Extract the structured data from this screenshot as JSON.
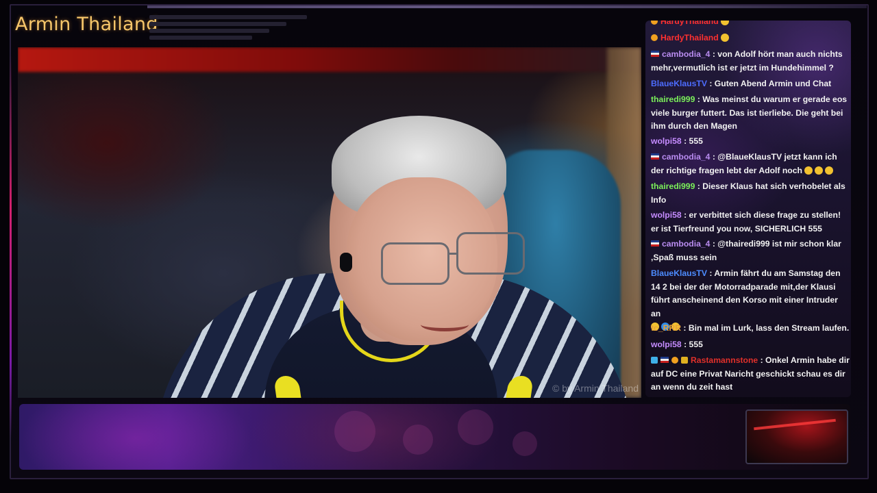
{
  "stream": {
    "title": "Armin Thailand",
    "watermark": "© by Armin Thailand"
  },
  "colors": {
    "title": "#f6c66a",
    "accent_pink": "#d4206e",
    "accent_purple": "#7a1aa8",
    "chat_bg": "#1b1430"
  },
  "chat": {
    "messages": [
      {
        "user": "HardyThailand",
        "text": "",
        "name_color": "#ff3030",
        "badges": [
          "sub-badge-icon"
        ],
        "emotes": [
          "clap-emoji-icon"
        ]
      },
      {
        "user": "cambodia_4",
        "text": ": von Adolf hört man auch nichts mehr,vermutlich ist er jetzt im Hundehimmel ?",
        "name_color": "#b98cf0",
        "badges": [
          "thai-flag-icon"
        ],
        "emotes": []
      },
      {
        "user": "BlaueKlausTV",
        "text": ": Guten Abend Armin und Chat",
        "name_color": "#4d6cff",
        "badges": [],
        "emotes": []
      },
      {
        "user": "thairedi999",
        "text": ": Was meinst du warum er gerade eos viele burger futtert. Das ist tierliebe. Die geht bei ihm durch den Magen",
        "name_color": "#7bf05a",
        "badges": [],
        "emotes": []
      },
      {
        "user": "wolpi58",
        "text": ": 555",
        "name_color": "#c58cff",
        "badges": [],
        "emotes": []
      },
      {
        "user": "cambodia_4",
        "text": ": @BlaueKlausTV jetzt kann ich der richtige fragen lebt der Adolf noch",
        "name_color": "#b98cf0",
        "badges": [
          "thai-flag-icon"
        ],
        "emotes": [
          "laugh-emoji-icon",
          "laugh-emoji-icon",
          "laugh-emoji-icon"
        ]
      },
      {
        "user": "thairedi999",
        "text": ": Dieser Klaus hat sich verhobelet als Info",
        "name_color": "#7bf05a",
        "badges": [],
        "emotes": []
      },
      {
        "user": "wolpi58",
        "text": ": er verbittet sich diese frage zu stellen! er ist Tierfreund you now, SICHERLICH 555",
        "name_color": "#c58cff",
        "badges": [],
        "emotes": []
      },
      {
        "user": "cambodia_4",
        "text": ": @thairedi999 ist mir schon klar ,Spaß muss sein",
        "name_color": "#b98cf0",
        "badges": [
          "thai-flag-icon"
        ],
        "emotes": []
      },
      {
        "user": "BlaueKlausTV",
        "text": ": Armin fährt du am Samstag den 14 2 bei der der Motorradparade mit,der Klausi führt anscheinend den Korso mit einer Intruder an",
        "name_color": "#4d8cff",
        "badges": [],
        "emotes": [
          "laugh-emoji-icon",
          "blue-heart-icon",
          "laugh-emoji-icon"
        ]
      },
      {
        "user": "tc_RRR",
        "text": ": Bin mal im Lurk, lass den Stream laufen.",
        "name_color": "#e8a23a",
        "badges": [],
        "emotes": []
      },
      {
        "user": "wolpi58",
        "text": ": 555",
        "name_color": "#c58cff",
        "badges": [],
        "emotes": []
      },
      {
        "user": "Rastamannstone",
        "text": ": Onkel Armin habe dir auf DC eine Privat Naricht geschickt schau es dir an wenn du zeit hast",
        "name_color": "#e0302a",
        "badges": [
          "vip-badge-icon",
          "thai-flag-icon",
          "sub-badge-icon",
          "crown-badge-icon"
        ],
        "emotes": []
      }
    ]
  }
}
